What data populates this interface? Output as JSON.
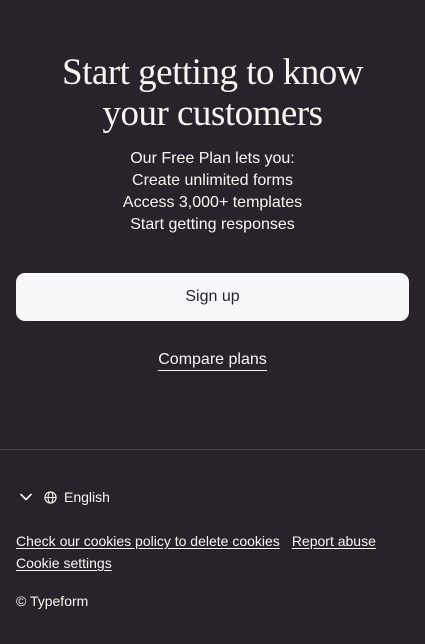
{
  "hero": {
    "headline_line1": "Start getting to know",
    "headline_line2": "your customers",
    "benefits": [
      "Our Free Plan lets you:",
      "Create unlimited forms",
      "Access 3,000+ templates",
      "Start getting responses"
    ],
    "signup_label": "Sign up",
    "compare_label": "Compare plans"
  },
  "footer": {
    "language": "English",
    "language_toggle_icon": "chevron-down-icon",
    "language_icon": "globe-icon",
    "links": {
      "cookies_policy": "Check our cookies policy to delete cookies",
      "report_abuse": "Report abuse",
      "cookie_settings": "Cookie settings"
    },
    "copyright": "© Typeform"
  },
  "colors": {
    "background": "#28232a",
    "button_bg": "#f8f8fa",
    "text": "#f7f6f2"
  }
}
